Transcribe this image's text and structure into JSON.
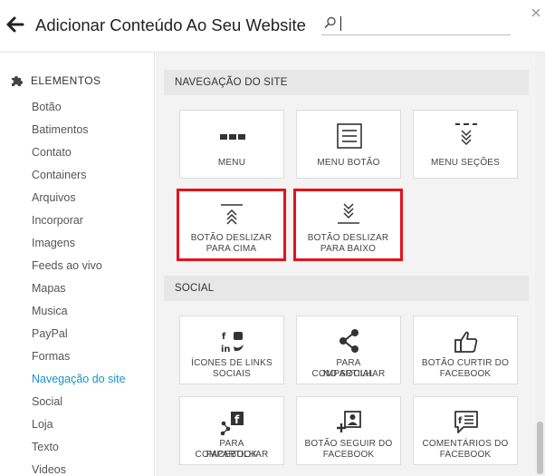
{
  "header": {
    "title": "Adicionar Conteúdo Ao Seu Website",
    "search_value": "",
    "back_icon": "arrow-left-icon",
    "close_icon": "close-icon",
    "search_icon": "search-icon"
  },
  "sidebar": {
    "heading": "ELEMENTOS",
    "heading_icon": "puzzle-piece-icon",
    "items": [
      {
        "label": "Botão"
      },
      {
        "label": "Batimentos"
      },
      {
        "label": "Contato"
      },
      {
        "label": "Containers"
      },
      {
        "label": "Arquivos"
      },
      {
        "label": "Incorporar"
      },
      {
        "label": "Imagens"
      },
      {
        "label": "Feeds ao vivo"
      },
      {
        "label": "Mapas"
      },
      {
        "label": "Musica"
      },
      {
        "label": "PayPal"
      },
      {
        "label": "Formas"
      },
      {
        "label": "Navegação do site",
        "active": true
      },
      {
        "label": "Social"
      },
      {
        "label": "Loja"
      },
      {
        "label": "Texto"
      },
      {
        "label": "Videos"
      }
    ]
  },
  "sections": [
    {
      "title": "NAVEGAÇÃO DO SITE",
      "tiles": [
        {
          "line1": "MENU",
          "line2": "",
          "icon": "menu-dots-icon"
        },
        {
          "line1": "MENU BOTÃO",
          "line2": "",
          "icon": "menu-button-icon"
        },
        {
          "line1": "MENU SEÇÕES",
          "line2": "",
          "icon": "menu-sections-icon"
        },
        {
          "line1": "BOTÃO DESLIZAR",
          "line2": "PARA CIMA",
          "icon": "scroll-up-icon",
          "highlighted": true
        },
        {
          "line1": "BOTÃO DESLIZAR",
          "line2": "PARA BAIXO",
          "icon": "scroll-down-icon",
          "highlighted": true
        }
      ]
    },
    {
      "title": "SOCIAL",
      "tiles": [
        {
          "line1": "ÍCONES DE LINKS",
          "line2": "SOCIAIS",
          "icon": "social-links-icon"
        },
        {
          "line1": "PARA COMPARTILHAR",
          "line2": "NO SOCIAL",
          "icon": "share-icon"
        },
        {
          "line1": "BOTÃO CURTIR DO",
          "line2": "FACEBOOK",
          "icon": "thumbs-up-icon"
        },
        {
          "line1": "PARA COMPARTILHAR",
          "line2": "FACEBOOK",
          "icon": "facebook-share-icon"
        },
        {
          "line1": "BOTÃO SEGUIR DO",
          "line2": "FACEBOOK",
          "icon": "facebook-follow-icon"
        },
        {
          "line1": "COMENTÁRIOS DO",
          "line2": "FACEBOOK",
          "icon": "facebook-comments-icon"
        }
      ]
    }
  ],
  "colors": {
    "highlight": "#e3131b",
    "active_link": "#1b8fc9",
    "panel_bg": "#f3f3f3",
    "section_bar": "#e7e7e7"
  }
}
